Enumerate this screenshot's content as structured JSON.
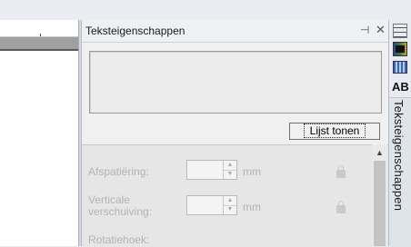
{
  "panel": {
    "title": "Teksteigenschappen",
    "pin_icon": "pin-icon",
    "close_icon": "close-icon",
    "list_button_label": "Lijst tonen"
  },
  "fields": [
    {
      "label": "Afspatiëring:",
      "unit": "mm",
      "value": ""
    },
    {
      "label": "Verticale\nverschuiving:",
      "unit": "mm",
      "value": ""
    },
    {
      "label": "Rotatiehoek:"
    }
  ],
  "right_toolbar": {
    "icons": [
      "grid-icon",
      "colorbar-icon",
      "pattern-icon"
    ],
    "text_icon_label": "AB",
    "vertical_tab_label": "Teksteigenschappen"
  }
}
